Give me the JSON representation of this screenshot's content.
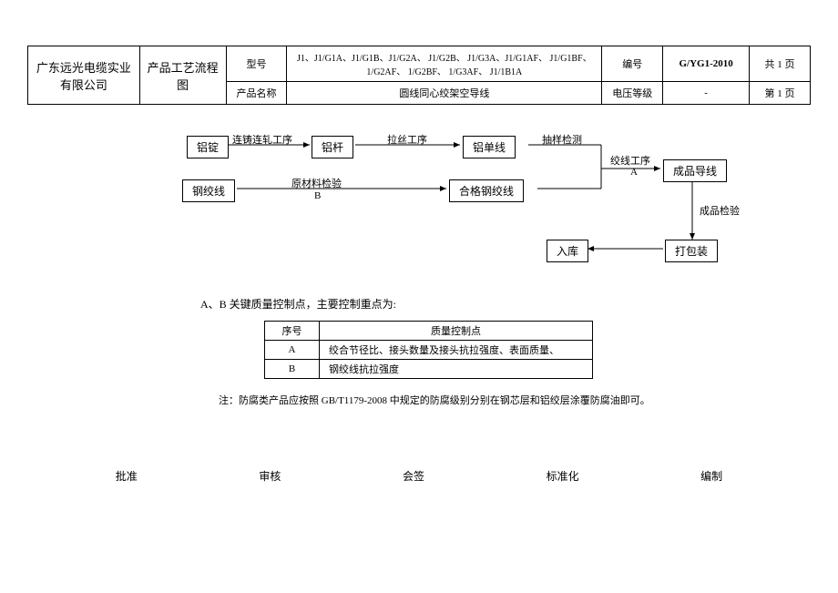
{
  "header": {
    "company": "广东远光电缆实业有限公司",
    "doc_type": "产品工艺流程图",
    "label_model": "型号",
    "model_value": "J1、J1/G1A、J1/G1B、J1/G2A、 J1/G2B、 J1/G3A、J1/G1AF、 J1/G1BF、 1/G2AF、 1/G2BF、 1/G3AF、 J1/1B1A",
    "label_code": "编号",
    "code_value": "G/YG1-2010",
    "page_total": "共 1 页",
    "label_name": "产品名称",
    "name_value": "圆线同心绞架空导线",
    "label_voltage": "电压等级",
    "voltage_value": "-",
    "page_current": "第 1 页"
  },
  "flow": {
    "n_al_ingot": "铝锭",
    "n_al_rod": "铝杆",
    "n_al_wire": "铝单线",
    "n_steel_strand": "钢绞线",
    "n_ok_steel": "合格钢绞线",
    "n_product": "成品导线",
    "n_pack": "打包装",
    "n_store": "入库",
    "l_cast": "连铸连轧工序",
    "l_draw": "拉丝工序",
    "l_sample": "抽样检测",
    "l_raw_insp": "原材料检验",
    "l_raw_b": "B",
    "l_strand": "绞线工序",
    "l_strand_a": "A",
    "l_prod_insp": "成品检验"
  },
  "qc": {
    "intro": "A、B 关键质量控制点，主要控制重点为:",
    "th_no": "序号",
    "th_point": "质量控制点",
    "row_a_no": "A",
    "row_a_point": "绞合节径比、接头数量及接头抗拉强度、表面质量、",
    "row_b_no": "B",
    "row_b_point": "钢绞线抗拉强度"
  },
  "note": "注：防腐类产品应按照 GB/T1179-2008 中规定的防腐级别分别在钢芯层和铝绞层涂覆防腐油即可。",
  "footer": {
    "approve": "批准",
    "review": "审核",
    "countersign": "会签",
    "standardize": "标准化",
    "prepare": "编制"
  },
  "chart_data": {
    "type": "flowchart",
    "nodes": [
      {
        "id": "al_ingot",
        "label": "铝锭"
      },
      {
        "id": "al_rod",
        "label": "铝杆"
      },
      {
        "id": "al_wire",
        "label": "铝单线"
      },
      {
        "id": "steel_strand",
        "label": "钢绞线"
      },
      {
        "id": "ok_steel",
        "label": "合格钢绞线"
      },
      {
        "id": "product",
        "label": "成品导线"
      },
      {
        "id": "pack",
        "label": "打包装"
      },
      {
        "id": "store",
        "label": "入库"
      }
    ],
    "edges": [
      {
        "from": "al_ingot",
        "to": "al_rod",
        "label": "连铸连轧工序"
      },
      {
        "from": "al_rod",
        "to": "al_wire",
        "label": "拉丝工序"
      },
      {
        "from": "al_wire",
        "to": "product",
        "label": "抽样检测 → 绞线工序 A"
      },
      {
        "from": "steel_strand",
        "to": "ok_steel",
        "label": "原材料检验 B"
      },
      {
        "from": "ok_steel",
        "to": "product",
        "label": ""
      },
      {
        "from": "product",
        "to": "pack",
        "label": "成品检验"
      },
      {
        "from": "pack",
        "to": "store",
        "label": ""
      }
    ]
  }
}
